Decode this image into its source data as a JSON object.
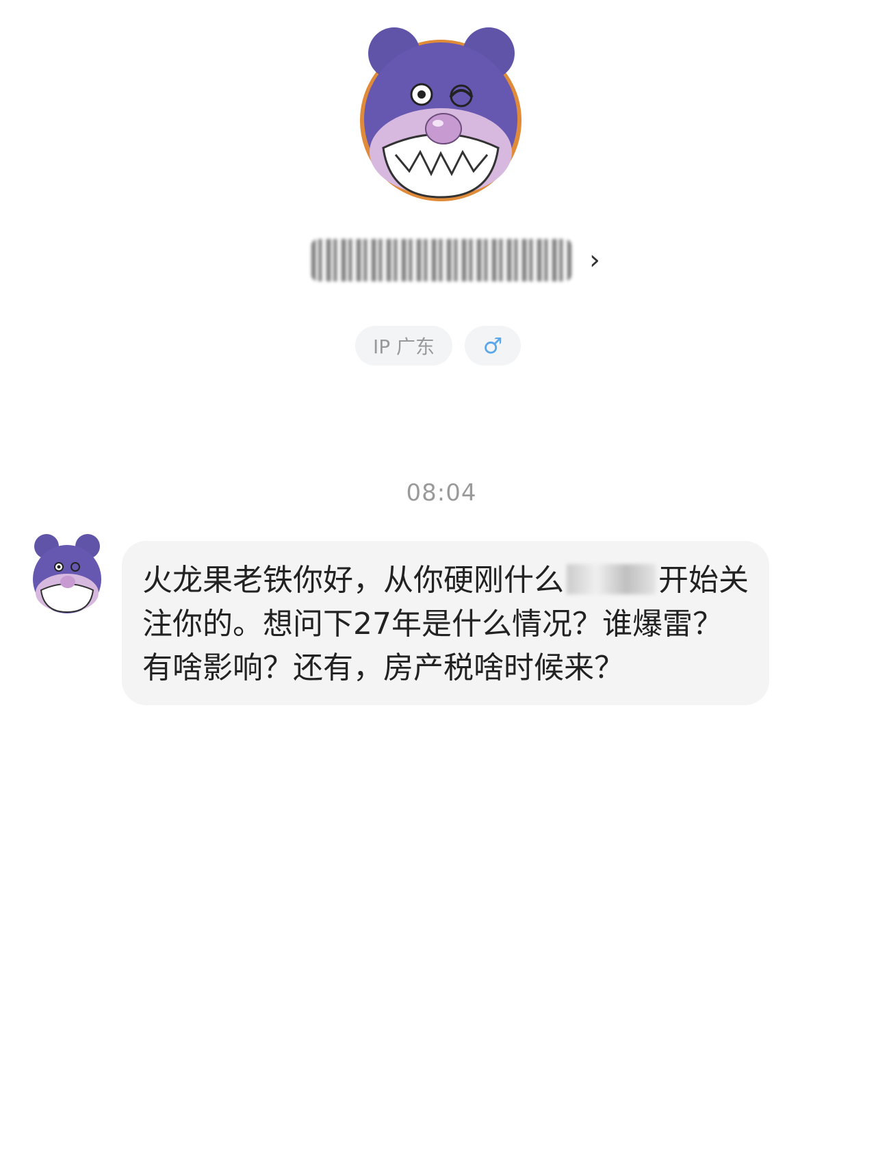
{
  "profile": {
    "location_tag": "IP 广东",
    "gender_tag": "♂",
    "chevron": "›"
  },
  "chat": {
    "timestamp": "08:04",
    "message": {
      "part1": "火龙果老铁你好，从你硬刚什么",
      "part2": "开始关注你的。想问下27年是什么情况？谁爆雷？有啥影响？还有，房产税啥时候来？"
    }
  }
}
